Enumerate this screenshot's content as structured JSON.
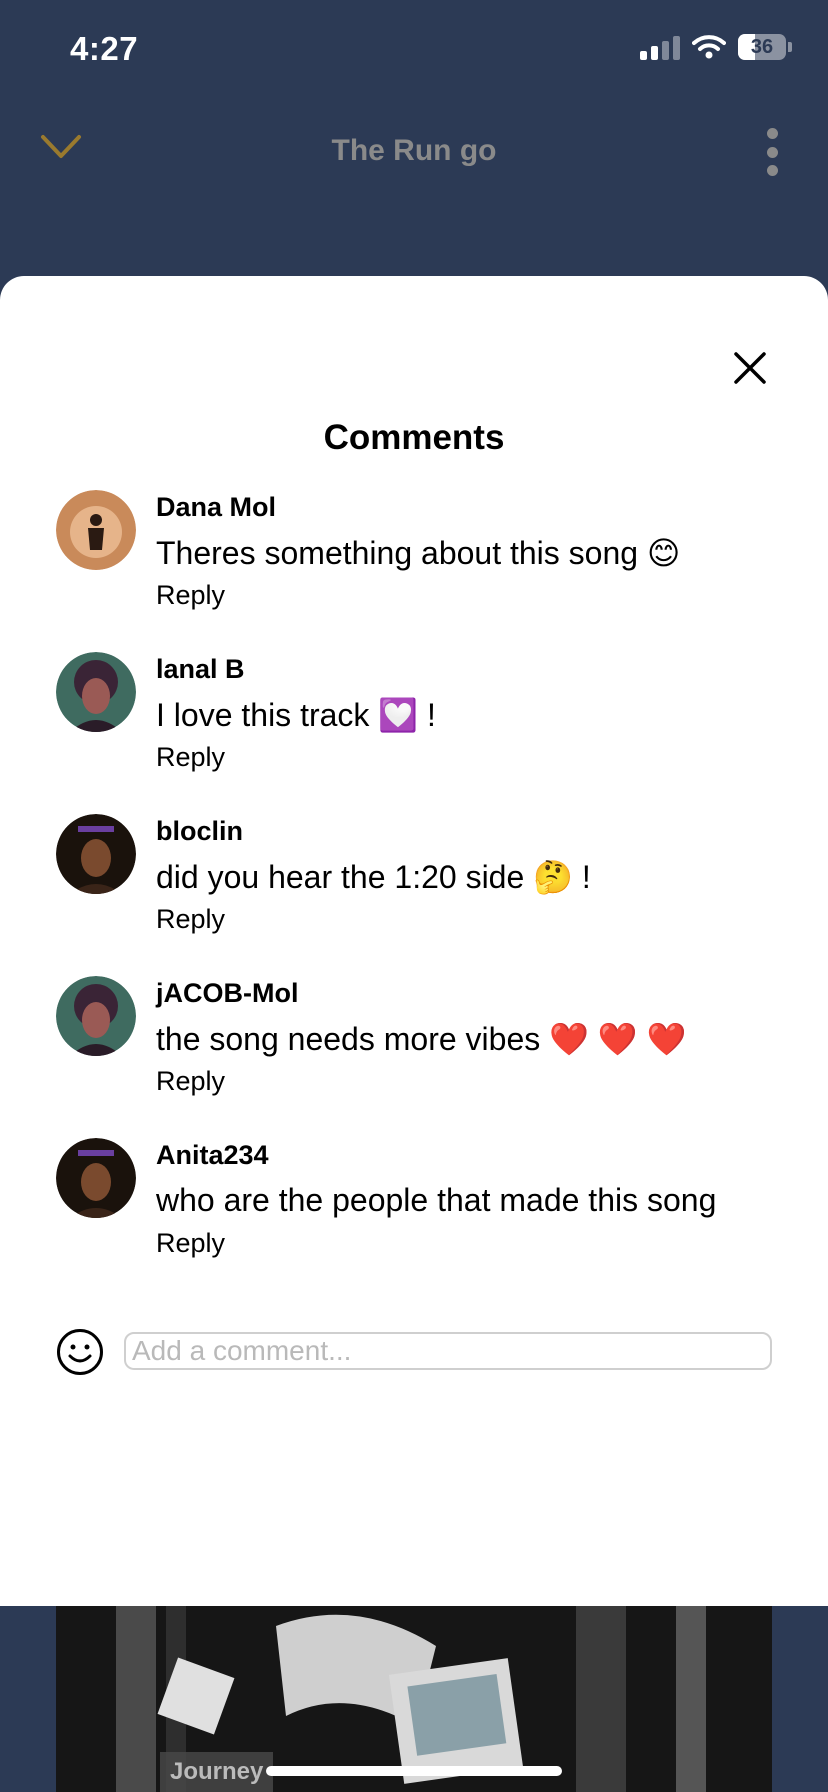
{
  "status": {
    "time": "4:27",
    "battery": "36"
  },
  "player": {
    "title": "The Run go"
  },
  "comments_sheet": {
    "title": "Comments",
    "comments": [
      {
        "user": "Dana Mol",
        "text": "Theres something about this song 😊",
        "reply": "Reply"
      },
      {
        "user": "lanal B",
        "text": "I love this track 💟  !",
        "reply": "Reply"
      },
      {
        "user": "bloclin",
        "text": "did you hear the 1:20 side 🤔 !",
        "reply": "Reply"
      },
      {
        "user": "jACOB-Mol",
        "text": "the song needs more vibes ❤️ ❤️ ❤️",
        "reply": "Reply"
      },
      {
        "user": "Anita234",
        "text": "who are the people that made this song",
        "reply": "Reply"
      }
    ],
    "input_placeholder": "Add a comment..."
  },
  "artwork": {
    "label": "Journey"
  },
  "colors": {
    "header_bg": "#2c3a55",
    "chevron": "#9a7a2e",
    "muted": "#8a8a8a"
  }
}
